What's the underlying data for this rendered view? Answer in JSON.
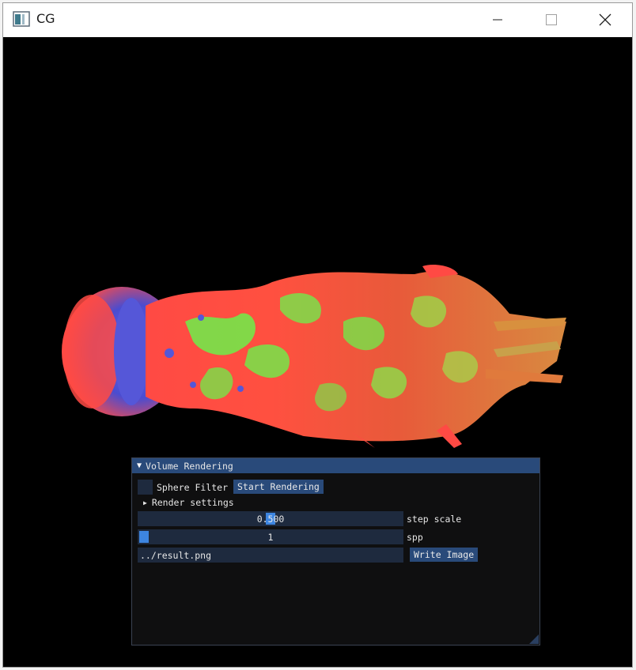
{
  "window": {
    "title": "CG",
    "app_icon": "app-window-icon",
    "controls": {
      "minimize": "minimize-icon",
      "maximize": "maximize-icon",
      "close": "close-icon"
    }
  },
  "colors": {
    "viewport_bg": "#000000",
    "panel_header": "#294a7a",
    "frame_bg": "#1e2a3e",
    "slider_grab": "#3d85e0",
    "smoke_red": "#ff4a44",
    "smoke_green": "#6cf04a",
    "sphere_blue": "#5a5ad8"
  },
  "panel": {
    "title": "Volume Rendering",
    "collapse_icon": "triangle-down-icon",
    "sphere_filter": {
      "label": "Sphere Filter",
      "checked": false
    },
    "start_rendering_label": "Start Rendering",
    "render_settings": {
      "label": "Render settings",
      "icon": "triangle-right-icon",
      "expanded": false
    },
    "step_scale": {
      "value": "0.500",
      "label": "step scale",
      "fraction": 0.5
    },
    "spp": {
      "value": "1",
      "label": "spp",
      "fraction": 0.0
    },
    "output_path": {
      "value": "../result.png"
    },
    "write_image_label": "Write Image"
  }
}
